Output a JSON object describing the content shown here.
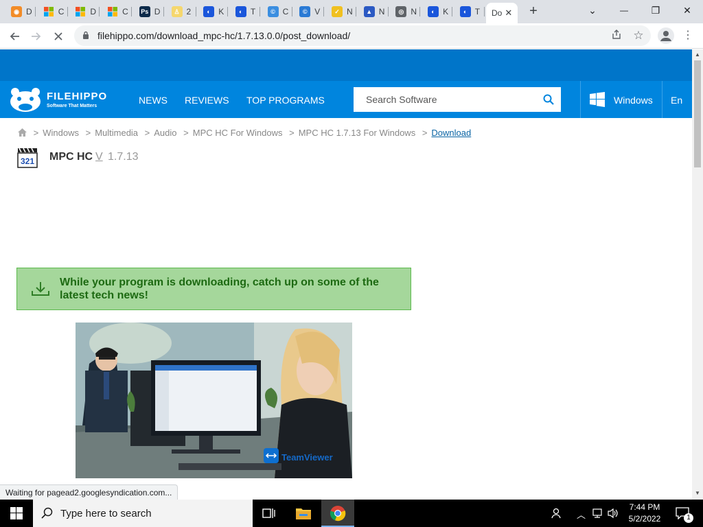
{
  "browser": {
    "tabs": [
      {
        "label": "D",
        "fav_color": "#f28c28",
        "fav_glyph": "◉"
      },
      {
        "label": "C",
        "fav_color": "#ffffff",
        "fav_glyph": "ms"
      },
      {
        "label": "D",
        "fav_color": "#ffffff",
        "fav_glyph": "ms"
      },
      {
        "label": "C",
        "fav_color": "#ffffff",
        "fav_glyph": "ms"
      },
      {
        "label": "D",
        "fav_color": "#0b2a4a",
        "fav_glyph": "Ps"
      },
      {
        "label": "2",
        "fav_color": "#f5d76e",
        "fav_glyph": "♙"
      },
      {
        "label": "K",
        "fav_color": "#1a56db",
        "fav_glyph": "◐"
      },
      {
        "label": "T",
        "fav_color": "#1a56db",
        "fav_glyph": "◐"
      },
      {
        "label": "C",
        "fav_color": "#3b8ee0",
        "fav_glyph": "©"
      },
      {
        "label": "V",
        "fav_color": "#2a7ad5",
        "fav_glyph": "©"
      },
      {
        "label": "N",
        "fav_color": "#f0c020",
        "fav_glyph": "✓"
      },
      {
        "label": "N",
        "fav_color": "#2b59c3",
        "fav_glyph": "▲"
      },
      {
        "label": "N",
        "fav_color": "#5f6368",
        "fav_glyph": "◎"
      },
      {
        "label": "K",
        "fav_color": "#1a56db",
        "fav_glyph": "◐"
      },
      {
        "label": "T",
        "fav_color": "#1a56db",
        "fav_glyph": "◐"
      }
    ],
    "active_tab": {
      "label": "Do",
      "close": "✕"
    },
    "new_tab": "+",
    "window_controls": {
      "list": "⌄",
      "minimize": "—",
      "restore": "❐",
      "close": "✕"
    },
    "url": "filehippo.com/download_mpc-hc/1.7.13.0.0/post_download/",
    "status": "Waiting for pagead2.googlesyndication.com..."
  },
  "site": {
    "logo_name": "FILEHIPPO",
    "logo_tagline": "Software That Matters",
    "nav": [
      "NEWS",
      "REVIEWS",
      "TOP PROGRAMS"
    ],
    "search_placeholder": "Search Software",
    "platform": "Windows",
    "language": "En",
    "colors": {
      "topband": "#0075c9",
      "navbar": "#0085de",
      "notice_bg": "#a5d79b",
      "notice_text": "#1d6a12"
    }
  },
  "breadcrumb": [
    "Windows",
    "Multimedia",
    "Audio",
    "MPC HC For Windows",
    "MPC HC 1.7.13 For Windows"
  ],
  "breadcrumb_current": "Download",
  "program": {
    "name": "MPC HC",
    "v_prefix": "V",
    "version": "1.7.13",
    "icon_text": "321"
  },
  "notice": {
    "text": "While your program is downloading, catch up on some of the latest tech news!"
  },
  "ad": {
    "brand": "TeamViewer"
  },
  "taskbar": {
    "search_placeholder": "Type here to search",
    "time": "7:44 PM",
    "date": "5/2/2022",
    "notification_count": "1"
  }
}
